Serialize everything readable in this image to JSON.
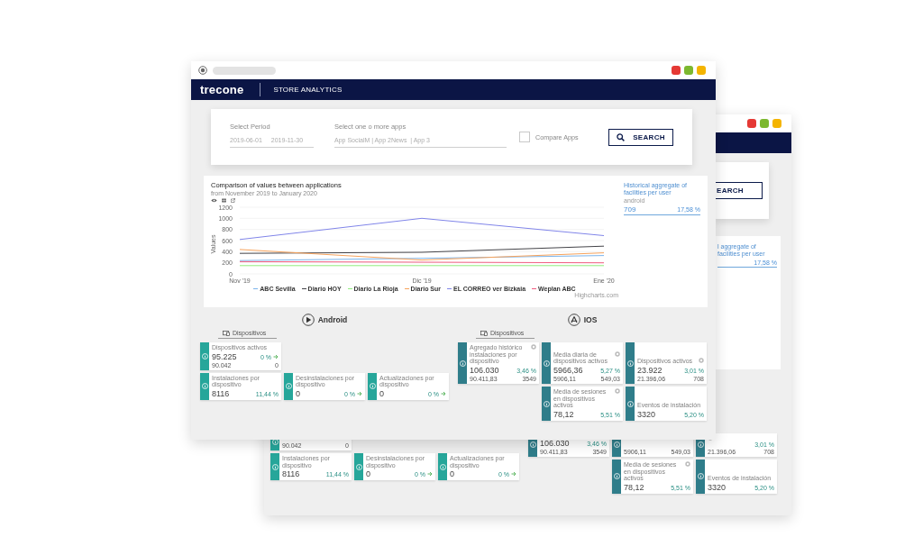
{
  "back_window": {
    "title_bar": {
      "traffic_lights": [
        {
          "color": "#e53935"
        },
        {
          "color": "#7cb82f"
        },
        {
          "color": "#f4b400"
        }
      ]
    },
    "search_button": "EARCH",
    "summary": {
      "title": "l aggregate of facilities per user",
      "change": "17,58 %"
    },
    "platforms": [
      {
        "kind": "android",
        "card_rows": [
          [
            {
              "prev": "90.042",
              "count": "0"
            }
          ],
          [
            {
              "title": "Instalaciones por dispositivo",
              "value": "8116",
              "change": "11,44 %"
            },
            {
              "title": "Desinstalaciones por dispositivo",
              "value": "0",
              "change": "0 %",
              "trend_icon": true
            },
            {
              "title": "Actualizaciones por dispositivo",
              "value": "0",
              "change": "0 %",
              "trend_icon": true
            }
          ]
        ]
      },
      {
        "kind": "ios",
        "card_rows": [
          [
            {
              "value": "106.030",
              "change": "3,46 %",
              "prev": "90.411,83",
              "count": "3549"
            },
            {
              "prev": "5906,11",
              "count": "549,03"
            },
            {
              "change": "3,01 %",
              "prev": "21.396,06",
              "count": "708",
              "help_icon": true
            }
          ],
          [
            {
              "title": "Media de sesiones en dispositivos activos",
              "value": "78,12",
              "change": "5,51 %",
              "help_icon": true
            },
            {
              "title": "Eventos de instalación",
              "value": "3320",
              "change": "5,20 %"
            }
          ]
        ]
      }
    ]
  },
  "front_window": {
    "title_bar": {
      "traffic_lights": [
        {
          "color": "#e53935"
        },
        {
          "color": "#7cb82f"
        },
        {
          "color": "#f4b400"
        }
      ]
    },
    "header": {
      "logo": "trecone",
      "title": "STORE ANALYTICS"
    },
    "filters": {
      "period_label": "Select Period",
      "period_start": "2019-06-01",
      "period_end": "2019-11-30",
      "apps_label": "Select one o more apps",
      "apps_value": "App SocialM | App 2News  | App 3",
      "compare": {
        "label": "Compare Apps",
        "checked": false
      },
      "search_button": "SEARCH"
    },
    "chart_card": {
      "title": "Comparison of values between applications",
      "subtitle": "from November 2019 to January 2020",
      "chart_data": {
        "type": "line",
        "grid": true,
        "ylabel": "Values",
        "categories": [
          "Nov '19",
          "Dic '19",
          "Ene '20"
        ],
        "ylim": [
          0,
          1200
        ],
        "yticks": [
          0,
          200,
          400,
          600,
          800,
          1000,
          1200
        ],
        "series": [
          {
            "name": "ABC Sevilla",
            "color": "#7cb5ec",
            "values": [
              240,
              280,
              330
            ]
          },
          {
            "name": "Diario HOY",
            "color": "#434348",
            "values": [
              370,
              390,
              500
            ]
          },
          {
            "name": "Diario La Rioja",
            "color": "#90ed7d",
            "values": [
              150,
              150,
              150
            ]
          },
          {
            "name": "Diario Sur",
            "color": "#f7a35c",
            "values": [
              440,
              250,
              380
            ]
          },
          {
            "name": "EL CORREO ver Bizkaia",
            "color": "#8085e9",
            "values": [
              620,
              1000,
              690
            ]
          },
          {
            "name": "Weplan ABC",
            "color": "#f15c80",
            "values": [
              220,
              210,
              200
            ]
          }
        ]
      },
      "credit": "Highcharts.com",
      "summary": {
        "title": "Historical aggregate of facilities per user",
        "subtitle": "android",
        "value": "709",
        "change": "17,58 %"
      }
    },
    "platforms": [
      {
        "name": "Android",
        "kind": "android",
        "tab": {
          "label": "Dispositivos",
          "selected": true
        },
        "card_rows": [
          [
            {
              "title": "Dispositivos activos",
              "value": "95.225",
              "change": "0 %",
              "trend_icon": true,
              "prev": "90.042",
              "count": "0"
            }
          ],
          [
            {
              "title": "Instalaciones por dispositivo",
              "value": "8116",
              "change": "11,44 %"
            },
            {
              "title": "Desinstalaciones por dispositivo",
              "value": "0",
              "change": "0 %",
              "trend_icon": true
            },
            {
              "title": "Actualizaciones por dispositivo",
              "value": "0",
              "change": "0 %",
              "trend_icon": true
            }
          ]
        ]
      },
      {
        "name": "IOS",
        "kind": "ios",
        "tab": {
          "label": "Dispositivos",
          "selected": true
        },
        "card_rows": [
          [
            {
              "title": "Agregado histórico instalaciones por dispositivo",
              "value": "106.030",
              "change": "3,46 %",
              "prev": "90.411,83",
              "count": "3549",
              "help_icon": true
            },
            {
              "title": "Media diaria de dispositivos activos",
              "value": "5966,36",
              "change": "5,27 %",
              "prev": "5906,11",
              "count": "549,03",
              "help_icon": true
            },
            {
              "title": "Dispositivos activos",
              "value": "23.922",
              "change": "3,01 %",
              "prev": "21.396,06",
              "count": "708",
              "help_icon": true
            }
          ],
          [
            {
              "title": "Media de sesiones en dispositivos activos",
              "value": "78,12",
              "change": "5,51 %",
              "help_icon": true
            },
            {
              "title": "Eventos de instalación",
              "value": "3320",
              "change": "5,20 %"
            }
          ]
        ]
      }
    ]
  }
}
